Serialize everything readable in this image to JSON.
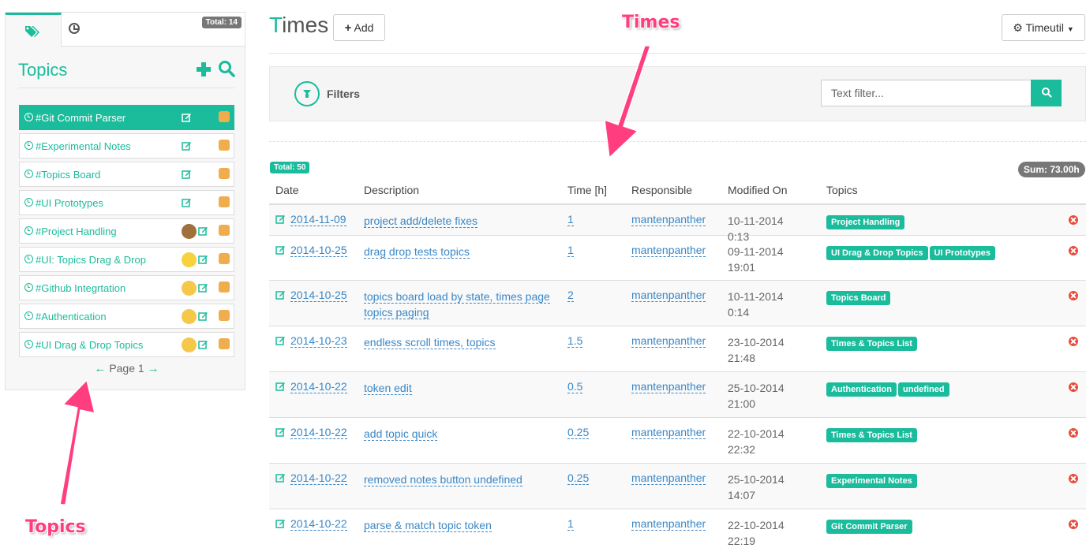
{
  "sidebar": {
    "total_badge": "Total: 14",
    "title": "Topics",
    "topics": [
      {
        "name": "#Git Commit Parser",
        "active": true,
        "emoji": ""
      },
      {
        "name": "#Experimental Notes",
        "active": false,
        "emoji": ""
      },
      {
        "name": "#Topics Board",
        "active": false,
        "emoji": ""
      },
      {
        "name": "#UI Prototypes",
        "active": false,
        "emoji": ""
      },
      {
        "name": "#Project Handling",
        "active": false,
        "emoji": "monkey-face"
      },
      {
        "name": "#UI: Topics Drag & Drop",
        "active": false,
        "emoji": "smiley-face"
      },
      {
        "name": "#Github Integrtation",
        "active": false,
        "emoji": "sweat-face"
      },
      {
        "name": "#Authentication",
        "active": false,
        "emoji": "sweat-face"
      },
      {
        "name": "#UI Drag & Drop Topics",
        "active": false,
        "emoji": "winking-tongue-face"
      }
    ],
    "pager_label": "Page 1"
  },
  "header": {
    "title_first": "T",
    "title_rest": "imes",
    "add_label": "Add",
    "timeutil_label": "Timeutil"
  },
  "filters": {
    "label": "Filters",
    "text_placeholder": "Text filter..."
  },
  "summary": {
    "total": "Total: 50",
    "sum": "Sum: 73.00h"
  },
  "table": {
    "columns": [
      "Date",
      "Description",
      "Time [h]",
      "Responsible",
      "Modified On",
      "Topics"
    ],
    "rows": [
      {
        "date": "2014-11-09",
        "desc": "project add/delete fixes",
        "time": "1",
        "resp": "mantenpanther",
        "mod": "10-11-2014 0:13",
        "topics": [
          "Project Handling"
        ]
      },
      {
        "date": "2014-10-25",
        "desc": "drag drop tests topics",
        "time": "1",
        "resp": "mantenpanther",
        "mod": "09-11-2014 19:01",
        "topics": [
          "UI Drag & Drop Topics",
          "UI Prototypes"
        ]
      },
      {
        "date": "2014-10-25",
        "desc": "topics board load by state, times page topics paging",
        "time": "2",
        "resp": "mantenpanther",
        "mod": "10-11-2014 0:14",
        "topics": [
          "Topics Board"
        ]
      },
      {
        "date": "2014-10-23",
        "desc": "endless scroll times, topics",
        "time": "1.5",
        "resp": "mantenpanther",
        "mod": "23-10-2014 21:48",
        "topics": [
          "Times & Topics List"
        ]
      },
      {
        "date": "2014-10-22",
        "desc": "token edit",
        "time": "0.5",
        "resp": "mantenpanther",
        "mod": "25-10-2014 21:00",
        "topics": [
          "Authentication",
          "undefined"
        ]
      },
      {
        "date": "2014-10-22",
        "desc": "add topic quick",
        "time": "0.25",
        "resp": "mantenpanther",
        "mod": "22-10-2014 22:32",
        "topics": [
          "Times & Topics List"
        ]
      },
      {
        "date": "2014-10-22",
        "desc": "removed notes button undefined",
        "time": "0.25",
        "resp": "mantenpanther",
        "mod": "25-10-2014 14:07",
        "topics": [
          "Experimental Notes"
        ]
      },
      {
        "date": "2014-10-22",
        "desc": "parse & match topic token",
        "time": "1",
        "resp": "mantenpanther",
        "mod": "22-10-2014 22:19",
        "topics": [
          "Git Commit Parser"
        ]
      }
    ]
  },
  "annotations": {
    "times": "Times",
    "topics": "Topics"
  },
  "colors": {
    "accent": "#1abc9c",
    "link": "#3a87c6",
    "topic_square": "#f0ad4e",
    "annotation": "#ff3d7f",
    "delete": "#e74c3c"
  }
}
